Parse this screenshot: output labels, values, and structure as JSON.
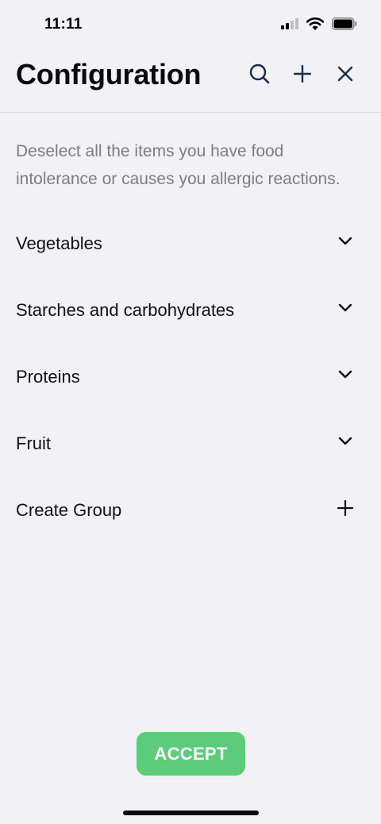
{
  "status_bar": {
    "time": "11:11",
    "signal_icon": "cellular-signal-icon",
    "wifi_icon": "wifi-icon",
    "battery_icon": "battery-icon"
  },
  "header": {
    "title": "Configuration",
    "actions": [
      {
        "icon": "search-icon"
      },
      {
        "icon": "plus-icon"
      },
      {
        "icon": "close-icon"
      }
    ]
  },
  "description": "Deselect all the items you have food intolerance or causes you allergic reactions.",
  "groups": [
    {
      "label": "Vegetables",
      "icon": "chevron-down-icon"
    },
    {
      "label": "Starches and carbohydrates",
      "icon": "chevron-down-icon"
    },
    {
      "label": "Proteins",
      "icon": "chevron-down-icon"
    },
    {
      "label": "Fruit",
      "icon": "chevron-down-icon"
    }
  ],
  "create_group": {
    "label": "Create Group",
    "icon": "plus-icon"
  },
  "accept_button": {
    "label": "ACCEPT"
  },
  "colors": {
    "background": "#f2f1f6",
    "accent_navy": "#1c2b48",
    "accept_green": "#5dcc7a",
    "description_gray": "#7d7d84"
  }
}
